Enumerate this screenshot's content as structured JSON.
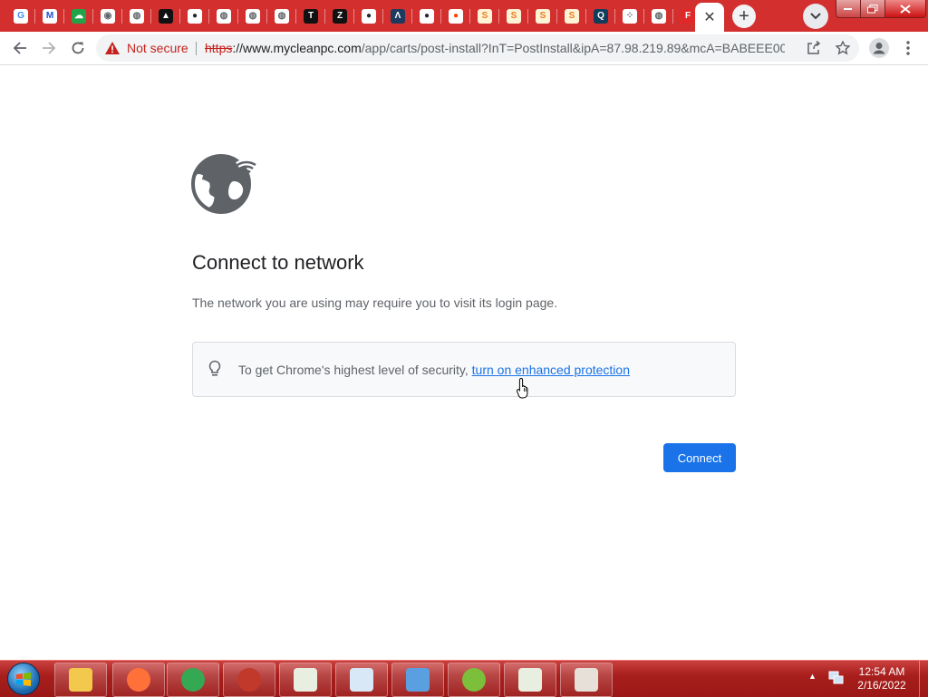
{
  "tabs": [
    {
      "icon": "google-icon",
      "glyph": "G",
      "color": "#ffffff",
      "fg": "#4285f4"
    },
    {
      "icon": "malwarebytes-icon",
      "glyph": "M",
      "color": "#ffffff",
      "fg": "#1d4ed8"
    },
    {
      "icon": "green-cloud-icon",
      "glyph": "☁",
      "color": "#22a34a",
      "fg": "#ffffff"
    },
    {
      "icon": "chrome-icon",
      "glyph": "◉",
      "color": "#ffffff",
      "fg": "#5f6368"
    },
    {
      "icon": "globe-icon",
      "glyph": "◍",
      "color": "#ffffff",
      "fg": "#5f6368"
    },
    {
      "icon": "vercel-icon",
      "glyph": "▲",
      "color": "#111111",
      "fg": "#ffffff"
    },
    {
      "icon": "github-icon",
      "glyph": "●",
      "color": "#ffffff",
      "fg": "#24292f"
    },
    {
      "icon": "globe-icon",
      "glyph": "◍",
      "color": "#ffffff",
      "fg": "#5f6368"
    },
    {
      "icon": "globe-icon",
      "glyph": "◍",
      "color": "#ffffff",
      "fg": "#5f6368"
    },
    {
      "icon": "globe-icon",
      "glyph": "◍",
      "color": "#ffffff",
      "fg": "#5f6368"
    },
    {
      "icon": "tidal-icon",
      "glyph": "T",
      "color": "#111111",
      "fg": "#ffffff"
    },
    {
      "icon": "zlib-icon",
      "glyph": "Z",
      "color": "#111111",
      "fg": "#ffffff"
    },
    {
      "icon": "github-icon",
      "glyph": "●",
      "color": "#ffffff",
      "fg": "#24292f"
    },
    {
      "icon": "arc-icon",
      "glyph": "Λ",
      "color": "#1e3a5f",
      "fg": "#ffffff"
    },
    {
      "icon": "github-icon",
      "glyph": "●",
      "color": "#ffffff",
      "fg": "#24292f"
    },
    {
      "icon": "reddit-icon",
      "glyph": "●",
      "color": "#ffffff",
      "fg": "#ff4500"
    },
    {
      "icon": "scratch-icon",
      "glyph": "S",
      "color": "#fff3d6",
      "fg": "#e67e22"
    },
    {
      "icon": "scratch-icon",
      "glyph": "S",
      "color": "#fff3d6",
      "fg": "#e67e22"
    },
    {
      "icon": "scratch-icon",
      "glyph": "S",
      "color": "#fff3d6",
      "fg": "#e67e22"
    },
    {
      "icon": "scratch-icon",
      "glyph": "S",
      "color": "#fff3d6",
      "fg": "#e67e22"
    },
    {
      "icon": "qr-icon",
      "glyph": "Q",
      "color": "#0f3d5c",
      "fg": "#ffffff"
    },
    {
      "icon": "dots-icon",
      "glyph": "⁘",
      "color": "#ffffff",
      "fg": "#5f6368"
    },
    {
      "icon": "globe-icon",
      "glyph": "◍",
      "color": "#ffffff",
      "fg": "#5f6368"
    },
    {
      "icon": "flipboard-icon",
      "glyph": "F",
      "color": "#e12828",
      "fg": "#ffffff"
    }
  ],
  "active_tab": {
    "close_glyph": "✕"
  },
  "new_tab_glyph": "+",
  "omnibox": {
    "security_label": "Not secure",
    "url_scheme": "https",
    "url_host": "://www.mycleanpc.com",
    "url_rest": "/app/carts/post-install?InT=PostInstall&ipA=87.98.219.89&mcA=BABEEE00..."
  },
  "page": {
    "heading": "Connect to network",
    "description": "The network you are using may require you to visit its login page.",
    "info_text": "To get Chrome's highest level of security, ",
    "info_link": "turn on enhanced protection",
    "connect_button": "Connect"
  },
  "taskbar": {
    "apps": [
      {
        "name": "explorer-icon",
        "color": "#f2c94c"
      },
      {
        "name": "firefox-icon",
        "color": "#ff7139"
      },
      {
        "name": "chrome-icon",
        "color": "#34a853"
      },
      {
        "name": "red-app-icon",
        "color": "#c0392b"
      },
      {
        "name": "document-viewer-icon",
        "color": "#e8efe0"
      },
      {
        "name": "wordpad-icon",
        "color": "#d9e8f7"
      },
      {
        "name": "control-panel-icon",
        "color": "#5aa0e0"
      },
      {
        "name": "network-app-icon",
        "color": "#7bbf3a"
      },
      {
        "name": "document-viewer-icon",
        "color": "#e8efe0"
      },
      {
        "name": "archive-icon",
        "color": "#e6e0d8"
      }
    ],
    "time": "12:54 AM",
    "date": "2/16/2022"
  }
}
